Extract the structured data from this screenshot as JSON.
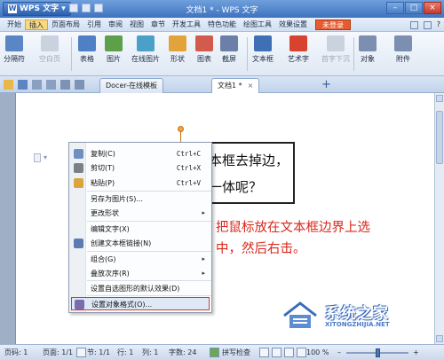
{
  "titlebar": {
    "app_name": "WPS 文字",
    "title": "文档1 * - WPS 文字",
    "win_min": "–",
    "win_max": "□",
    "win_close": "×"
  },
  "menubar": {
    "items": [
      {
        "label": "开始",
        "active": false
      },
      {
        "label": "插入",
        "active": true
      },
      {
        "label": "页面布局",
        "active": false
      },
      {
        "label": "引用",
        "active": false
      },
      {
        "label": "审阅",
        "active": false
      },
      {
        "label": "视图",
        "active": false
      },
      {
        "label": "章节",
        "active": false
      },
      {
        "label": "开发工具",
        "active": false
      },
      {
        "label": "特色功能",
        "active": false
      },
      {
        "label": "绘图工具",
        "active": false
      },
      {
        "label": "效果设置",
        "active": false
      }
    ],
    "login_label": "未登录",
    "help_label": "?"
  },
  "ribbon": {
    "buttons": [
      {
        "label": "分隔符",
        "icon": "page-break-icon",
        "color": "#5b86c6",
        "disabled": false
      },
      {
        "label": "空白页",
        "icon": "blank-page-icon",
        "color": "#c9d2de",
        "disabled": true
      },
      {
        "label": "表格",
        "icon": "table-icon",
        "color": "#4f7fc4",
        "disabled": false
      },
      {
        "label": "图片",
        "icon": "picture-icon",
        "color": "#5ea04a",
        "disabled": false
      },
      {
        "label": "在线图片",
        "icon": "online-picture-icon",
        "color": "#4aa0c8",
        "disabled": false
      },
      {
        "label": "形状",
        "icon": "shape-icon",
        "color": "#e2a43a",
        "disabled": false
      },
      {
        "label": "图表",
        "icon": "chart-icon",
        "color": "#d35b4e",
        "disabled": false
      },
      {
        "label": "截屏",
        "icon": "screenshot-icon",
        "color": "#6c7fa8",
        "disabled": false
      },
      {
        "label": "文本框",
        "icon": "textbox-icon",
        "color": "#3f6fb5",
        "disabled": false
      },
      {
        "label": "艺术字",
        "icon": "wordart-icon",
        "color": "#d8432f",
        "disabled": false
      },
      {
        "label": "首字下沉",
        "icon": "dropcap-icon",
        "color": "#c9d2de",
        "disabled": true
      },
      {
        "label": "对象",
        "icon": "object-icon",
        "color": "#7d8fb0",
        "disabled": false
      },
      {
        "label": "附件",
        "icon": "attachment-icon",
        "color": "#7d8fb0",
        "disabled": false
      }
    ]
  },
  "tabs": {
    "docer_label": "Docer-在线模板",
    "doc_label": "文档1 *",
    "close": "×",
    "new_tab": "+"
  },
  "document": {
    "textbox_line1": "本框去掉边，",
    "textbox_line2": "一体呢？",
    "annotation_line1": "把鼠标放在文本框边界上选",
    "annotation_line2": "中，然后右击。"
  },
  "context_menu": {
    "items": [
      {
        "label": "复制(C)",
        "shortcut": "Ctrl+C",
        "icon": "copy-icon",
        "submenu": false,
        "highlighted": false
      },
      {
        "label": "剪切(T)",
        "shortcut": "Ctrl+X",
        "icon": "cut-icon",
        "submenu": false,
        "highlighted": false
      },
      {
        "label": "粘贴(P)",
        "shortcut": "Ctrl+V",
        "icon": "paste-icon",
        "submenu": false,
        "highlighted": false
      },
      {
        "label": "另存为图片(S)...",
        "shortcut": "",
        "icon": "",
        "submenu": false,
        "highlighted": false
      },
      {
        "label": "更改形状",
        "shortcut": "",
        "icon": "",
        "submenu": true,
        "highlighted": false
      },
      {
        "label": "编辑文字(X)",
        "shortcut": "",
        "icon": "",
        "submenu": false,
        "highlighted": false
      },
      {
        "label": "创建文本框链接(N)",
        "shortcut": "",
        "icon": "link-icon",
        "submenu": false,
        "highlighted": false
      },
      {
        "label": "组合(G)",
        "shortcut": "",
        "icon": "",
        "submenu": true,
        "highlighted": false
      },
      {
        "label": "叠放次序(R)",
        "shortcut": "",
        "icon": "",
        "submenu": true,
        "highlighted": false
      },
      {
        "label": "设置自选图形的默认效果(D)",
        "shortcut": "",
        "icon": "",
        "submenu": false,
        "highlighted": false
      },
      {
        "label": "设置对象格式(O)...",
        "shortcut": "",
        "icon": "format-object-icon",
        "submenu": false,
        "highlighted": true
      }
    ],
    "submenu_arrow": "▸"
  },
  "statusbar": {
    "page_num": "页码: 1",
    "page_of": "页面: 1/1",
    "section": "节: 1/1",
    "row": "行: 1",
    "col": "列: 1",
    "word_count": "字数: 24",
    "spell_check": "拼写检查",
    "zoom_value": "100 %",
    "zoom_fraction": 0.52,
    "zoom_minus": "–",
    "zoom_plus": "+"
  },
  "watermark": {
    "site_name": "系统之家",
    "site_url": "XITONGZHIJIA.NET"
  },
  "colors": {
    "titlebar": "#3e72bf",
    "accent_red": "#d8281d",
    "login_orange": "#e85b2e",
    "highlight_border": "#d33a2c"
  }
}
